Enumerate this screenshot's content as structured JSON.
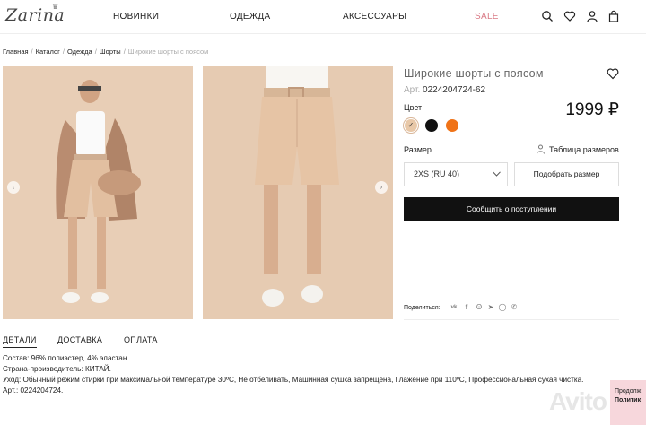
{
  "header": {
    "logo": "Zarina",
    "nav": [
      "НОВИНКИ",
      "ОДЕЖДА",
      "АКСЕССУАРЫ",
      "SALE"
    ],
    "icons": [
      "search-icon",
      "heart-icon",
      "user-icon",
      "bag-icon"
    ],
    "sale_color": "#d97a86"
  },
  "breadcrumb": [
    "Главная",
    "Каталог",
    "Одежда",
    "Шорты",
    "Широкие шорты с поясом"
  ],
  "product": {
    "title": "Широкие шорты с поясом",
    "sku_label": "Арт.",
    "sku": "0224204724-62",
    "color_label": "Цвет",
    "colors": [
      {
        "name": "beige",
        "hex": "#e8c8a8",
        "selected": true
      },
      {
        "name": "black",
        "hex": "#111111",
        "selected": false
      },
      {
        "name": "orange",
        "hex": "#f07318",
        "selected": false
      }
    ],
    "price": "1999 ₽",
    "size_label": "Размер",
    "size_table": "Таблица размеров",
    "selected_size": "2XS (RU 40)",
    "pick_size": "Подобрать размер",
    "notify": "Сообщить о поступлении",
    "share_label": "Поделиться:",
    "share_icons": [
      "vk-icon",
      "facebook-icon",
      "ok-icon",
      "telegram-icon",
      "whatsapp-icon",
      "viber-icon"
    ]
  },
  "tabs": [
    "ДЕТАЛИ",
    "ДОСТАВКА",
    "ОПЛАТА"
  ],
  "details": [
    "Состав: 96% полиэстер, 4% эластан.",
    "Страна-производитель: КИТАЙ.",
    "Уход: Обычный режим стирки при максимальной температуре 30ºС, Не отбеливать, Машинная сушка запрещена, Глажение при 110ºС, Профессиональная сухая чистка.",
    "Арт.: 0224204724."
  ],
  "cookie": {
    "line1": "Продолж",
    "line2": "Политик"
  }
}
